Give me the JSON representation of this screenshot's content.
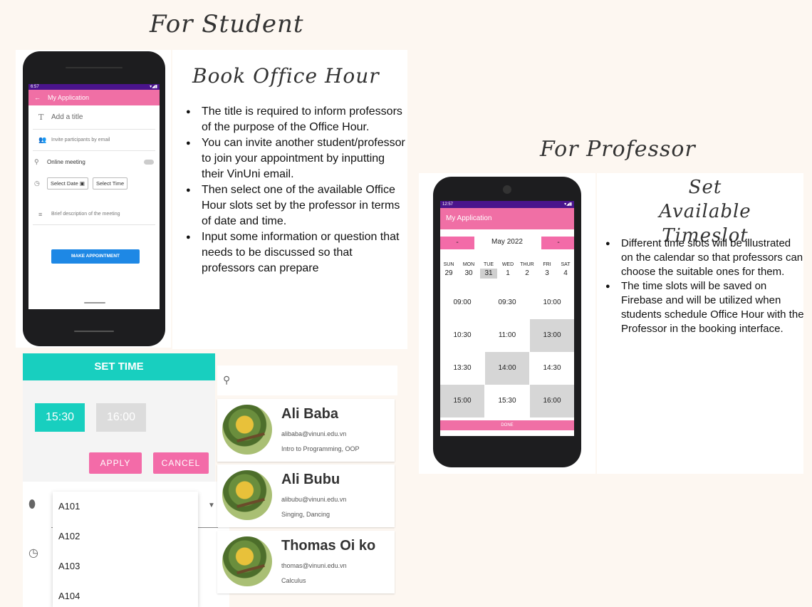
{
  "headings": {
    "for_student": "For Student",
    "for_professor": "For Professor"
  },
  "student_phone": {
    "status_time": "6:57",
    "app_title": "My Application",
    "title_placeholder": "Add a title",
    "invite_placeholder": "Invite participants by email",
    "online_meeting": "Online meeting",
    "select_date": "Select Date",
    "select_time": "Select Time",
    "description_placeholder": "Brief description of the meeting",
    "make_button": "MAKE APPOINTMENT"
  },
  "book_section": {
    "title": "Book Office Hour",
    "bullets": [
      "The title is required to inform professors of the purpose of the Office Hour.",
      "You can invite another student/professor to join your appointment by inputting their VinUni email.",
      "Then select one of the available Office Hour slots set by the professor in terms of date and time.",
      "Input some information or question that needs to be discussed so that professors can prepare"
    ]
  },
  "set_time_dialog": {
    "title": "SET TIME",
    "selected": "15:30",
    "unavailable": "16:00",
    "apply": "APPLY",
    "cancel": "CANCEL"
  },
  "rooms": [
    "A101",
    "A102",
    "A103",
    "A104"
  ],
  "contacts": [
    {
      "name": "Ali Baba",
      "email": "alibaba@vinuni.edu.vn",
      "subjects": "Intro to Programming, OOP"
    },
    {
      "name": "Ali Bubu",
      "email": "alibubu@vinuni.edu.vn",
      "subjects": "Singing, Dancing"
    },
    {
      "name": "Thomas Oi ko",
      "email": "thomas@vinuni.edu.vn",
      "subjects": "Calculus"
    }
  ],
  "prof_phone": {
    "status_time": "12:57",
    "app_title": "My Application",
    "prev": "-",
    "next": "-",
    "month": "May 2022",
    "days": [
      {
        "d": "SUN",
        "n": "29"
      },
      {
        "d": "MON",
        "n": "30"
      },
      {
        "d": "TUE",
        "n": "31"
      },
      {
        "d": "WED",
        "n": "1"
      },
      {
        "d": "THUR",
        "n": "2"
      },
      {
        "d": "FRI",
        "n": "3"
      },
      {
        "d": "SAT",
        "n": "4"
      }
    ],
    "slots": [
      "09:00",
      "09:30",
      "10:00",
      "10:30",
      "11:00",
      "13:00",
      "13:30",
      "14:00",
      "14:30",
      "15:00",
      "15:30",
      "16:00"
    ],
    "done": "DONE"
  },
  "timeslot_section": {
    "title_line1": "Set",
    "title_line2": "Available Timeslot",
    "bullets": [
      "Different time slots will be illustrated on the calendar so that professors can choose the suitable ones for them.",
      "The time slots will be saved on Firebase and will be utilized when students schedule Office Hour with the Professor in the booking interface."
    ]
  },
  "colors": {
    "pink": "#f06fa5",
    "teal": "#18cfbf",
    "blue": "#1e88e5",
    "purple": "#4a148c"
  }
}
